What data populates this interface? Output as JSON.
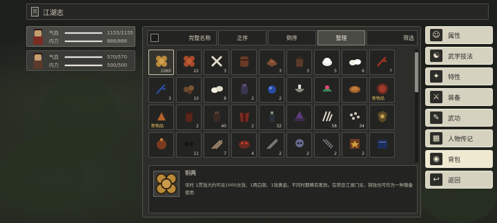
{
  "title": "江湖志",
  "party": [
    {
      "qi_label": "气血",
      "qi_value": "1155/1155",
      "qi_fill": 1.0,
      "neili_label": "内力",
      "neili_value": "888/888",
      "neili_fill": 1.0
    },
    {
      "qi_label": "气血",
      "qi_value": "570/570",
      "qi_fill": 1.0,
      "neili_label": "内力",
      "neili_value": "500/500",
      "neili_fill": 1.0
    }
  ],
  "tabs": {
    "complete": "完整名称",
    "asc": "正序",
    "desc": "倒序",
    "tidy": "整理",
    "filter": "筛选"
  },
  "items": [
    {
      "icon": "coins-icon",
      "qty": "1065"
    },
    {
      "icon": "copper-coins-icon",
      "qty": "22"
    },
    {
      "icon": "bones-icon",
      "qty": "3"
    },
    {
      "icon": "barrel-icon",
      "qty": ""
    },
    {
      "icon": "ore-icon",
      "qty": "3"
    },
    {
      "icon": "jar-icon",
      "qty": "3"
    },
    {
      "icon": "rice-icon",
      "qty": "5"
    },
    {
      "icon": "dumplings-icon",
      "qty": "6"
    },
    {
      "icon": "red-branch-icon",
      "qty": "7"
    },
    {
      "icon": "blue-branch-icon",
      "qty": "3"
    },
    {
      "icon": "brown-seeds-icon",
      "qty": "10"
    },
    {
      "icon": "white-buns-icon",
      "qty": "8"
    },
    {
      "icon": "purple-jar-icon",
      "qty": "2"
    },
    {
      "icon": "blue-gem-icon",
      "qty": "2"
    },
    {
      "icon": "bowl-icon",
      "qty": ""
    },
    {
      "icon": "green-herb-icon",
      "qty": ""
    },
    {
      "icon": "roast-meat-icon",
      "qty": ""
    },
    {
      "icon": "red-bowl-icon",
      "tag": "新物品"
    },
    {
      "icon": "claw-icon",
      "tag": "新物品"
    },
    {
      "icon": "red-jar-icon",
      "qty": "2"
    },
    {
      "icon": "dark-jar-icon",
      "qty": "40"
    },
    {
      "icon": "red-armor-icon",
      "qty": "2"
    },
    {
      "icon": "dark-bottle-icon",
      "qty": "32"
    },
    {
      "icon": "purple-hat-icon",
      "qty": ""
    },
    {
      "icon": "feathers-icon",
      "qty": "58"
    },
    {
      "icon": "pebbles-icon",
      "qty": "34"
    },
    {
      "icon": "shield-icon",
      "qty": ""
    },
    {
      "icon": "pouch-icon",
      "qty": ""
    },
    {
      "icon": "black-beads-icon",
      "qty": "11"
    },
    {
      "icon": "arrows-icon",
      "qty": "7"
    },
    {
      "icon": "red-beast-icon",
      "qty": "4"
    },
    {
      "icon": "spears-icon",
      "qty": "2"
    },
    {
      "icon": "skull-icon",
      "qty": "2"
    },
    {
      "icon": "chains-icon",
      "qty": "2"
    },
    {
      "icon": "scroll-box-icon",
      "qty": "2"
    },
    {
      "icon": "blue-book-icon",
      "qty": ""
    }
  ],
  "description": {
    "name": "铜两",
    "text": "宋时 1贯钱大约可兑1000文钱、1两白银、1钱黄金。不同时期略有差异。在禁忌江湖门派，铜钱也可作为一种籌备使用"
  },
  "menu": [
    {
      "label": "属性",
      "icon": "character-icon"
    },
    {
      "label": "武学技法",
      "icon": "martial-arts-icon"
    },
    {
      "label": "特性",
      "icon": "traits-icon"
    },
    {
      "label": "装备",
      "icon": "sword-icon"
    },
    {
      "label": "武功",
      "icon": "manual-icon"
    },
    {
      "label": "人物传记",
      "icon": "biography-icon"
    },
    {
      "label": "背包",
      "icon": "bag-icon"
    },
    {
      "label": "返回",
      "icon": "return-icon"
    }
  ]
}
